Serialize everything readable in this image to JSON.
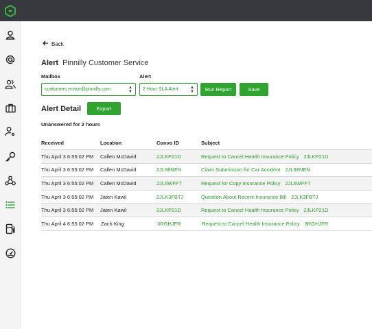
{
  "nav": {
    "back_label": "Back",
    "icons": [
      "logo-icon",
      "user-icon",
      "at-icon",
      "users-icon",
      "briefcase-icon",
      "user-settings-icon",
      "key-icon",
      "webhook-icon",
      "list-icon",
      "fuel-icon",
      "dashboard-icon"
    ]
  },
  "alert": {
    "label": "Alert",
    "name": "Pinnilly Customer Service"
  },
  "filters": {
    "mailbox_label": "Mailbox",
    "mailbox_value": "customers ervice@pinnilly.com",
    "alert_label": "Alert",
    "alert_value": "2 Hour SLA Alert",
    "run_report_label": "Run Report",
    "save_label": "Save"
  },
  "detail": {
    "title": "Alert Detail",
    "export_label": "Export",
    "subtitle": "Unanswered for 2 hours"
  },
  "table": {
    "headers": [
      "Received",
      "Location",
      "Convo ID",
      "Subject"
    ],
    "rows": [
      {
        "received": "Thu April 3 6:55:02 PM",
        "location": "Callen McDavid",
        "convo_id": "2JLKP21D",
        "subject": "Request to Cancel Health Insurance Policy",
        "subject_id": "2JLKP21D"
      },
      {
        "received": "Thu April 3 6:55:02 PM",
        "location": "Callen McDavid",
        "convo_id": "2JL98NEN",
        "subject": "Claim Submission for Car Accident",
        "subject_id": "2JL98NEN"
      },
      {
        "received": "Thu April 3 6:55:02 PM",
        "location": "Callen McDavid",
        "convo_id": "2JL6WFFT",
        "subject": "Request for Copy Insurance Policy",
        "subject_id": "2JL6WFFT"
      },
      {
        "received": "Thu April 3 6:55:02 PM",
        "location": "Jaten Kawil",
        "convo_id": "2JLK3FBTJ",
        "subject": "Question About Recent Insurance Bill",
        "subject_id": "2JLK3FBTJ"
      },
      {
        "received": "Thu April 3 6:55:02 PM",
        "location": "Jaten Kawil",
        "convo_id": "2JLKP21D",
        "subject": "Request to Cancel Health Insurance Policy",
        "subject_id": "2JLKP21D"
      },
      {
        "received": "Thu April 4 6:55:02 PM",
        "location": "Zach King",
        "convo_id": "3RGHJFR",
        "subject": "Request to Cancel Health Insurance Policy",
        "subject_id": "3RGHJFR"
      }
    ]
  },
  "colors": {
    "accent": "#2fa52f",
    "topbar": "#36393d"
  }
}
